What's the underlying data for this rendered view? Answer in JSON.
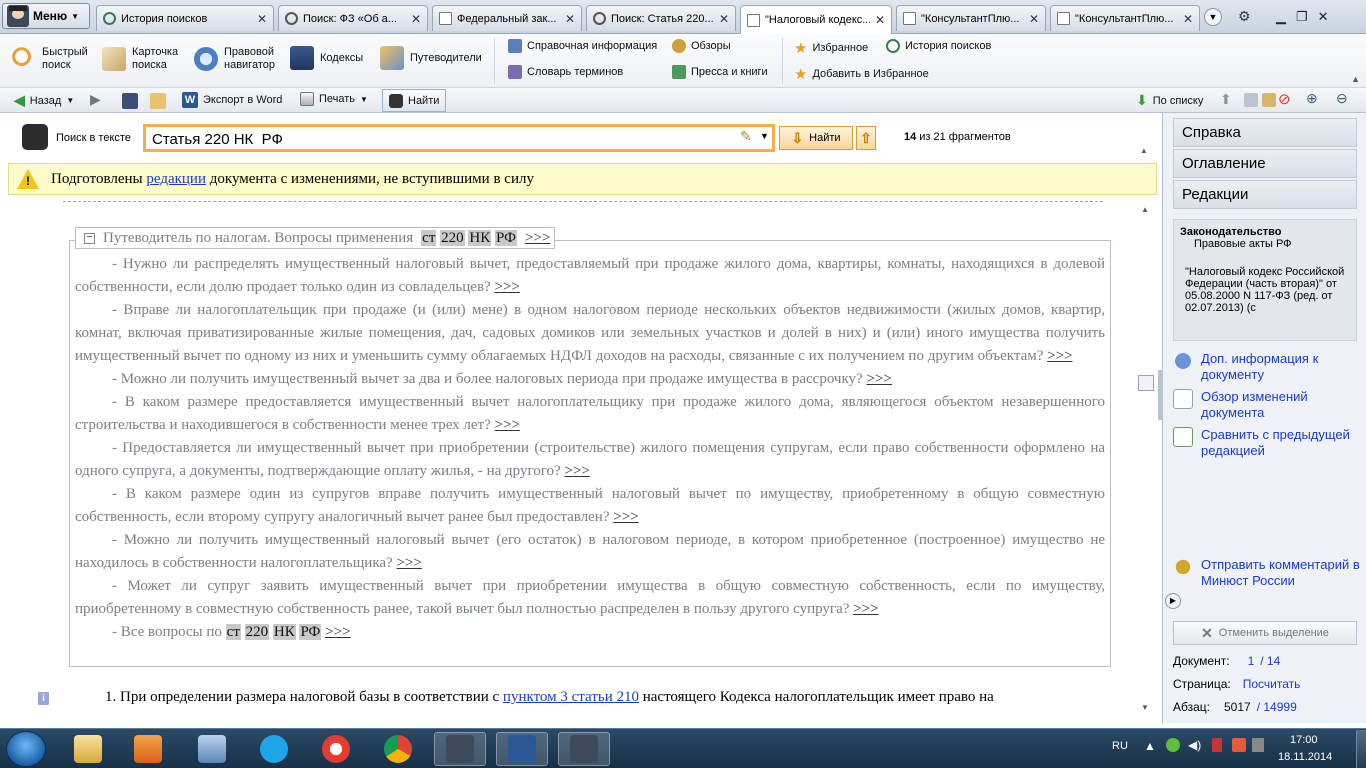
{
  "tabbar": {
    "menu_label": "Меню",
    "tabs": [
      {
        "label": "История поисков"
      },
      {
        "label": "Поиск: ФЗ «Об а..."
      },
      {
        "label": "Федеральный зак..."
      },
      {
        "label": "Поиск: Статья 220..."
      },
      {
        "label": "\"Налоговый кодекс..."
      },
      {
        "label": "\"КонсультантПлю..."
      },
      {
        "label": "\"КонсультантПлю..."
      }
    ]
  },
  "toolbar1": {
    "quick_search": "Быстрый поиск",
    "card_search": "Карточка поиска",
    "legal_nav": "Правовой навигатор",
    "codes": "Кодексы",
    "guides": "Путеводители",
    "reference_info": "Справочная информация",
    "reviews": "Обзоры",
    "favorites": "Избранное",
    "search_history": "История поисков",
    "glossary": "Словарь терминов",
    "press": "Пресса и книги",
    "add_favorites": "Добавить в Избранное"
  },
  "toolbar2": {
    "back": "Назад",
    "export_word": "Экспорт в Word",
    "print": "Печать",
    "find": "Найти",
    "by_list": "По списку"
  },
  "search": {
    "label": "Поиск в тексте",
    "value": "Статья 220 НК  РФ",
    "find_button": "Найти",
    "fragment_current": "14",
    "fragment_text": "из 21 фрагментов"
  },
  "notice": {
    "before": "Подготовлены",
    "link": "редакции",
    "after": "документа с изменениями, не вступившими в силу"
  },
  "guide": {
    "title": "Путеводитель по налогам. Вопросы применения",
    "hl1": "ст",
    "hl2": "220",
    "hl3": "НК",
    "hl4": "РФ",
    "arrows": ">>>",
    "items": [
      "- Нужно ли распределять имущественный налоговый вычет, предоставляемый при продаже жилого дома, квартиры, комнаты, находящихся в долевой собственности, если долю продает только один из совладельцев?",
      "- Вправе ли налогоплательщик при продаже (и (или) мене) в одном налоговом периоде нескольких объектов недвижимости (жилых домов, квартир, комнат, включая приватизированные жилые помещения, дач, садовых домиков или земельных участков и долей в них) и (или) иного имущества получить имущественный вычет по одному из них и уменьшить сумму облагаемых НДФЛ доходов на расходы, связанные с их получением по другим объектам?",
      "- Можно ли получить имущественный вычет за два и более налоговых периода при продаже имущества в рассрочку?",
      "- В каком размере предоставляется имущественный вычет налогоплательщику при продаже жилого дома, являющегося объектом незавершенного строительства и находившегося в собственности менее трех лет?",
      "- Предоставляется ли имущественный вычет при приобретении (строительстве) жилого помещения супругам, если право собственности оформлено на одного супруга, а документы, подтверждающие оплату жилья, - на другого?",
      "- В каком размере один из супругов вправе получить имущественный налоговый вычет по имуществу, приобретенному в общую совместную собственность, если второму супругу аналогичный вычет ранее был предоставлен?",
      "- Можно ли получить имущественный налоговый вычет (его остаток) в налоговом периоде, в котором приобретенное (построенное) имущество не находилось в собственности налогоплательщика?",
      "- Может ли супруг заявить имущественный вычет при приобретении имущества в общую совместную собственность, если по имуществу, приобретенному в совместную собственность ранее, такой вычет был полностью распределен в пользу другого супруга?"
    ],
    "all_questions": "- Все вопросы по"
  },
  "para1": {
    "before": "1. При определении размера налоговой базы в соответствии с",
    "link": "пунктом 3 статьи 210",
    "after": "настоящего Кодекса налогоплательщик имеет право на"
  },
  "rpanel": {
    "help": "Справка",
    "toc": "Оглавление",
    "editions": "Редакции",
    "law_title": "Законодательство",
    "law_sub": "Правовые акты РФ",
    "law_doc": "\"Налоговый кодекс Российской Федерации (часть вторая)\" от 05.08.2000 N 117-ФЗ (ред. от 02.07.2013) (с",
    "link_info": "Доп. информация к документу",
    "link_changes": "Обзор изменений документа",
    "link_compare": "Сравнить с предыдущей редакцией",
    "link_comment": "Отправить комментарий в Минюст России",
    "clear_selection": "Отменить выделение",
    "doc_label": "Документ:",
    "doc_current": "1",
    "doc_total": "/ 14",
    "page_label": "Страница:",
    "page_link": "Посчитать",
    "para_label": "Абзац:",
    "para_current": "5017",
    "para_total": "/ 14999"
  },
  "tray": {
    "lang": "RU",
    "time": "17:00",
    "date": "18.11.2014"
  }
}
